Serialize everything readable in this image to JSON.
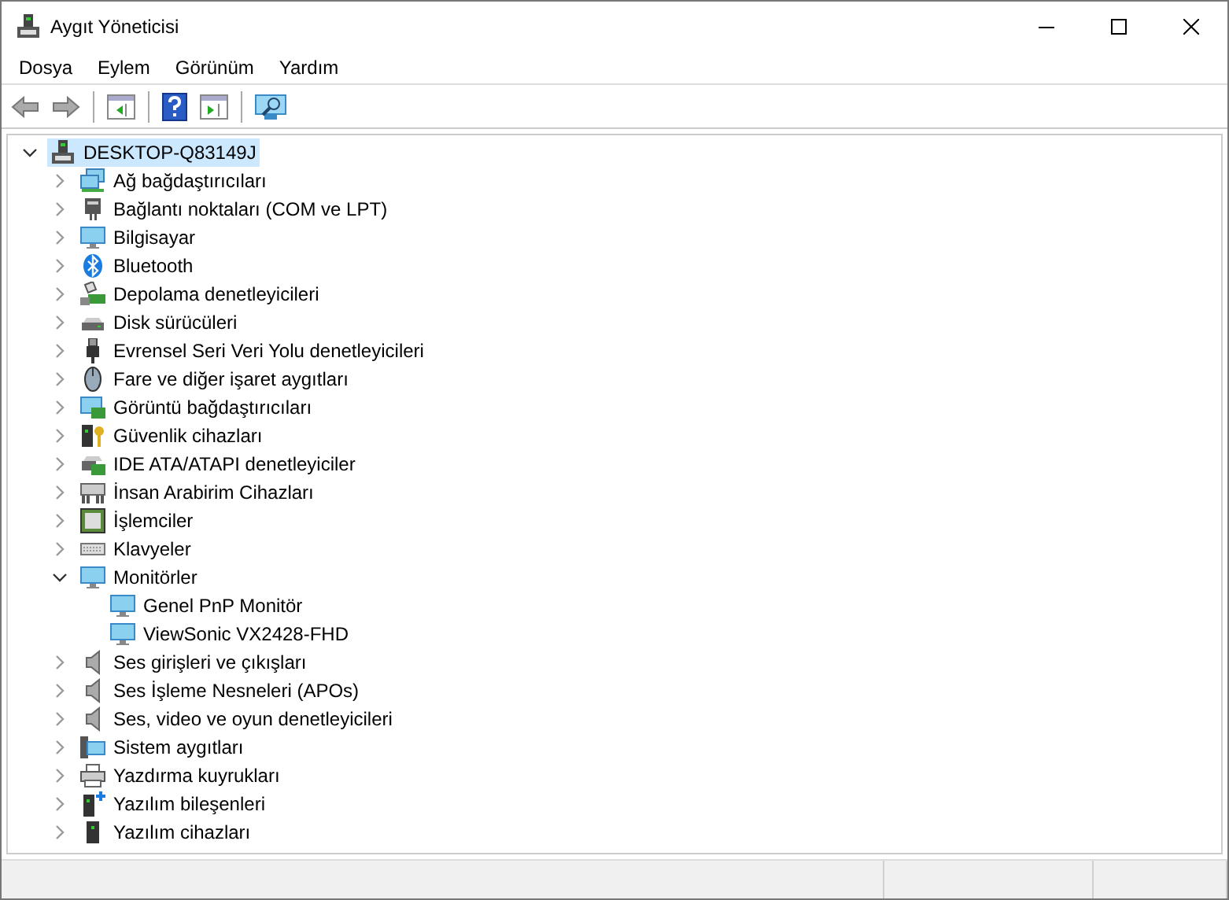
{
  "window": {
    "title": "Aygıt Yöneticisi"
  },
  "menu": [
    "Dosya",
    "Eylem",
    "Görünüm",
    "Yardım"
  ],
  "tree": [
    {
      "label": "DESKTOP-Q83149J",
      "kind": "pc",
      "selected": true,
      "expanded": true,
      "children": [
        {
          "label": "Ağ bağdaştırıcıları",
          "kind": "network",
          "selected": false,
          "expanded": false
        },
        {
          "label": "Bağlantı noktaları (COM ve LPT)",
          "kind": "port",
          "selected": false,
          "expanded": false
        },
        {
          "label": "Bilgisayar",
          "kind": "monitor",
          "selected": false,
          "expanded": false
        },
        {
          "label": "Bluetooth",
          "kind": "bluetooth",
          "selected": false,
          "expanded": false
        },
        {
          "label": "Depolama denetleyicileri",
          "kind": "storage",
          "selected": false,
          "expanded": false
        },
        {
          "label": "Disk sürücüleri",
          "kind": "disk",
          "selected": false,
          "expanded": false
        },
        {
          "label": "Evrensel Seri Veri Yolu denetleyicileri",
          "kind": "usb",
          "selected": false,
          "expanded": false
        },
        {
          "label": "Fare ve diğer işaret aygıtları",
          "kind": "mouse",
          "selected": false,
          "expanded": false
        },
        {
          "label": "Görüntü bağdaştırıcıları",
          "kind": "display",
          "selected": false,
          "expanded": false
        },
        {
          "label": "Güvenlik cihazları",
          "kind": "security",
          "selected": false,
          "expanded": false
        },
        {
          "label": "IDE ATA/ATAPI denetleyiciler",
          "kind": "ide",
          "selected": false,
          "expanded": false
        },
        {
          "label": "İnsan Arabirim Cihazları",
          "kind": "hid",
          "selected": false,
          "expanded": false
        },
        {
          "label": "İşlemciler",
          "kind": "cpu",
          "selected": false,
          "expanded": false
        },
        {
          "label": "Klavyeler",
          "kind": "keyboard",
          "selected": false,
          "expanded": false
        },
        {
          "label": "Monitörler",
          "kind": "monitor",
          "selected": false,
          "expanded": true,
          "children": [
            {
              "label": "Genel PnP Monitör",
              "kind": "monitor",
              "selected": false
            },
            {
              "label": "ViewSonic VX2428-FHD",
              "kind": "monitor",
              "selected": false
            }
          ]
        },
        {
          "label": "Ses girişleri ve çıkışları",
          "kind": "audio",
          "selected": false,
          "expanded": false
        },
        {
          "label": "Ses İşleme Nesneleri (APOs)",
          "kind": "audio",
          "selected": false,
          "expanded": false
        },
        {
          "label": "Ses, video ve oyun denetleyicileri",
          "kind": "audio",
          "selected": false,
          "expanded": false
        },
        {
          "label": "Sistem aygıtları",
          "kind": "system",
          "selected": false,
          "expanded": false
        },
        {
          "label": "Yazdırma kuyrukları",
          "kind": "printer",
          "selected": false,
          "expanded": false
        },
        {
          "label": "Yazılım bileşenleri",
          "kind": "softcomp",
          "selected": false,
          "expanded": false
        },
        {
          "label": "Yazılım cihazları",
          "kind": "softdev",
          "selected": false,
          "expanded": false
        }
      ]
    }
  ]
}
